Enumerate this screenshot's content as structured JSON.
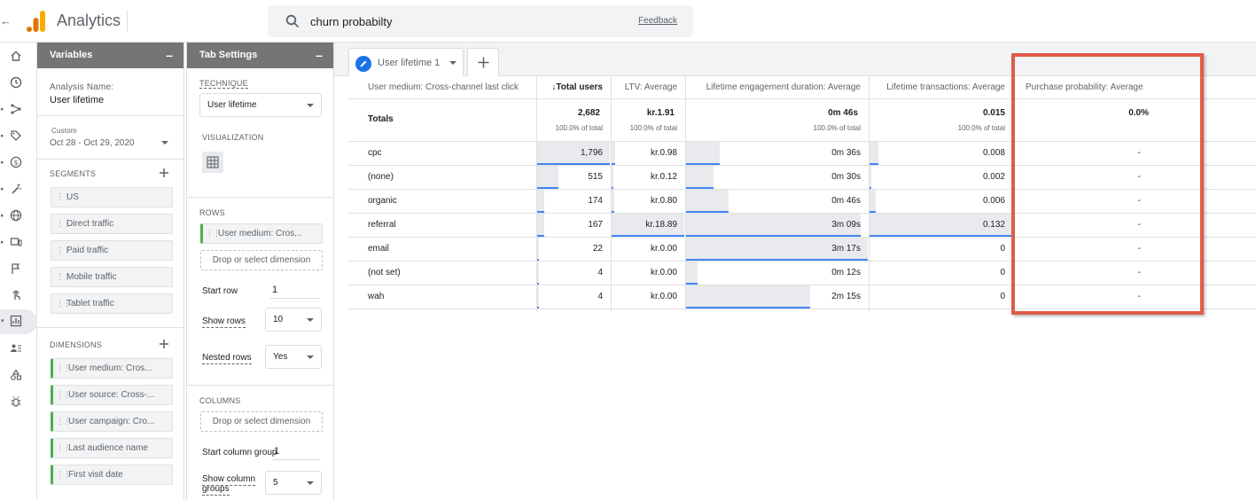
{
  "app": {
    "title": "Analytics"
  },
  "search": {
    "value": "churn probabilty",
    "feedback": "Feedback"
  },
  "leftnav": {
    "icons": [
      "home-icon",
      "clock-icon",
      "flow-icon",
      "tag-icon",
      "dollar-icon",
      "wand-icon",
      "globe-icon",
      "devices-icon",
      "flag-icon",
      "touch-icon",
      "explore-icon",
      "users-icon",
      "shapes-icon",
      "bug-icon"
    ]
  },
  "variables": {
    "header": "Variables",
    "minimize": "–",
    "analysis_name_label": "Analysis Name:",
    "analysis_name": "User lifetime",
    "date_label": "Custom",
    "date_range": "Oct 28 - Oct 29, 2020",
    "segments_label": "SEGMENTS",
    "segments": [
      "US",
      "Direct traffic",
      "Paid traffic",
      "Mobile traffic",
      "Tablet traffic"
    ],
    "dimensions_label": "DIMENSIONS",
    "dimensions": [
      "User medium: Cros...",
      "User source: Cross-...",
      "User campaign: Cro...",
      "Last audience name",
      "First visit date"
    ]
  },
  "tab_settings": {
    "header": "Tab Settings",
    "minimize": "–",
    "technique_label": "TECHNIQUE",
    "technique": "User lifetime",
    "visualization_label": "VISUALIZATION",
    "rows_label": "ROWS",
    "row_dimension": "User medium: Cros...",
    "drop_dimension": "Drop or select dimension",
    "start_row_label": "Start row",
    "start_row": "1",
    "show_rows_label": "Show rows",
    "show_rows": "10",
    "nested_rows_label": "Nested rows",
    "nested_rows": "Yes",
    "columns_label": "COLUMNS",
    "drop_column_dimension": "Drop or select dimension",
    "start_column_group_label": "Start column group",
    "start_column_group": "1",
    "show_column_groups_label_1": "Show column",
    "show_column_groups_label_2": "groups",
    "show_column_groups": "5"
  },
  "tabs": {
    "active_label": "User lifetime 1"
  },
  "table": {
    "headers": [
      "User medium: Cross-channel last click",
      "Total users",
      "LTV: Average",
      "Lifetime engagement duration: Average",
      "Lifetime transactions: Average",
      "Purchase probability: Average"
    ],
    "sort_arrow": "↓",
    "totals": {
      "label": "Totals",
      "values": [
        "2,682",
        "kr.1.91",
        "0m 46s",
        "0.015",
        "0.0%"
      ],
      "subs": [
        "100.0% of total",
        "100.0% of total",
        "100.0% of total",
        "100.0% of total"
      ]
    },
    "rows": [
      {
        "medium": "cpc",
        "users": "1,796",
        "ltv": "kr.0.98",
        "duration": "0m 36s",
        "transactions": "0.008",
        "probability": "-"
      },
      {
        "medium": "(none)",
        "users": "515",
        "ltv": "kr.0.12",
        "duration": "0m 30s",
        "transactions": "0.002",
        "probability": "-"
      },
      {
        "medium": "organic",
        "users": "174",
        "ltv": "kr.0.80",
        "duration": "0m 46s",
        "transactions": "0.006",
        "probability": "-"
      },
      {
        "medium": "referral",
        "users": "167",
        "ltv": "kr.18.89",
        "duration": "3m 09s",
        "transactions": "0.132",
        "probability": "-"
      },
      {
        "medium": "email",
        "users": "22",
        "ltv": "kr.0.00",
        "duration": "3m 17s",
        "transactions": "0",
        "probability": "-"
      },
      {
        "medium": "(not set)",
        "users": "4",
        "ltv": "kr.0.00",
        "duration": "0m 12s",
        "transactions": "0",
        "probability": "-"
      },
      {
        "medium": "wah",
        "users": "4",
        "ltv": "kr.0.00",
        "duration": "2m 15s",
        "transactions": "0",
        "probability": "-"
      }
    ],
    "bar_fractions": {
      "users": [
        1.0,
        0.287,
        0.097,
        0.093,
        0.012,
        0.002,
        0.002
      ],
      "ltv": [
        0.052,
        0.006,
        0.042,
        1.0,
        0.0,
        0.0,
        0.0
      ],
      "duration": [
        0.183,
        0.152,
        0.234,
        0.959,
        1.0,
        0.061,
        0.685
      ],
      "transactions": [
        0.061,
        0.015,
        0.045,
        1.0,
        0.0,
        0.0,
        0.0
      ]
    }
  },
  "colors": {
    "accent": "#4285f4",
    "highlight": "#e25b4a",
    "panel_header": "#757575"
  }
}
